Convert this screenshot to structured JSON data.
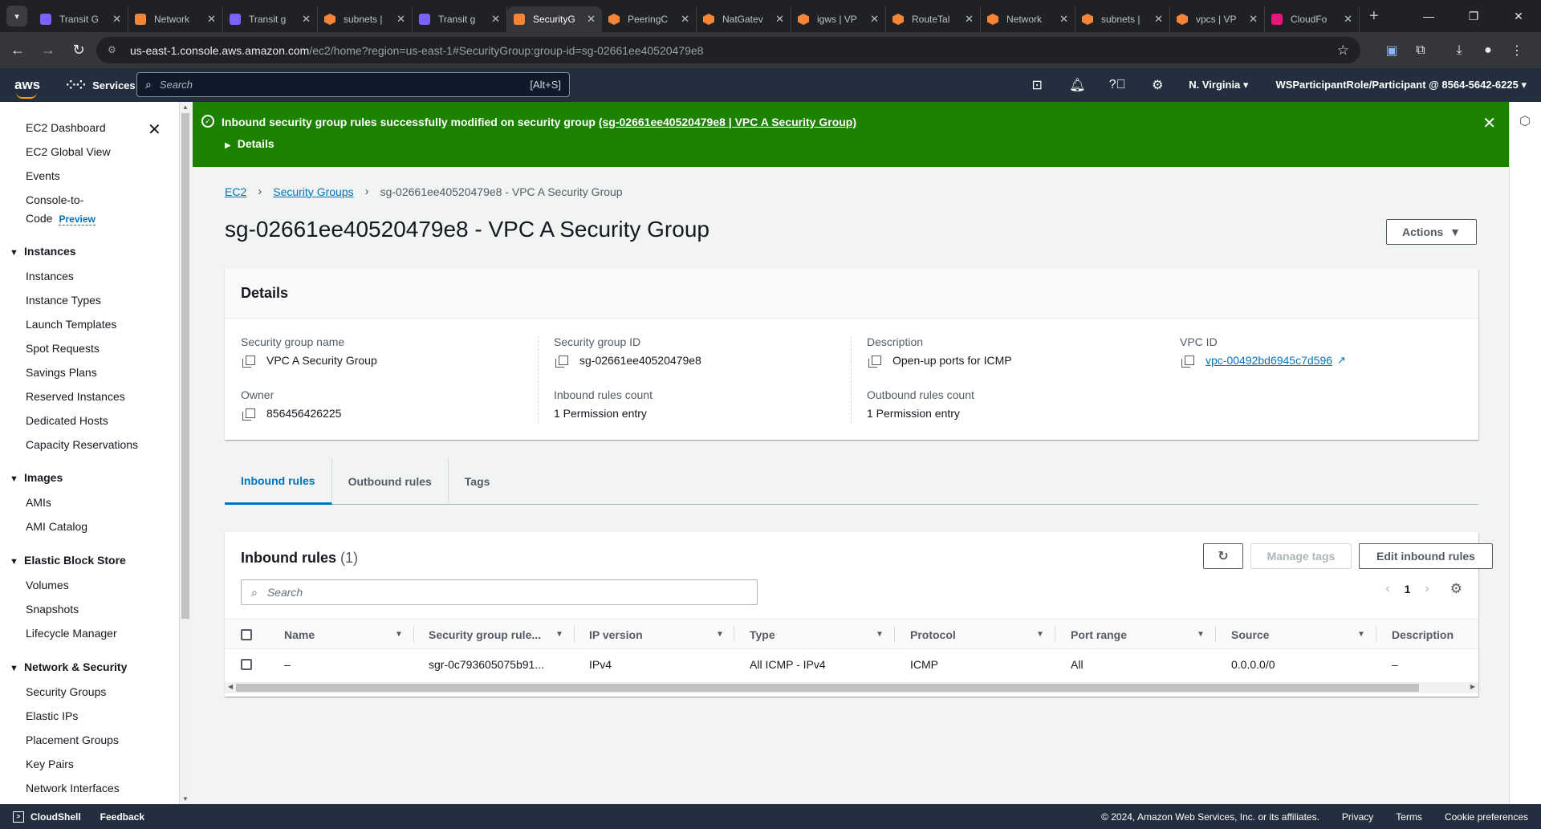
{
  "browser": {
    "menu_icon": "chevron-down-icon",
    "tabs": [
      {
        "label": "Transit G",
        "fav": "purple"
      },
      {
        "label": "Network",
        "fav": "orange"
      },
      {
        "label": "Transit g",
        "fav": "purple"
      },
      {
        "label": "subnets |",
        "fav": "hex"
      },
      {
        "label": "Transit g",
        "fav": "purple"
      },
      {
        "label": "SecurityG",
        "fav": "orange",
        "active": true
      },
      {
        "label": "PeeringC",
        "fav": "hex"
      },
      {
        "label": "NatGatev",
        "fav": "hex"
      },
      {
        "label": "igws | VP",
        "fav": "hex"
      },
      {
        "label": "RouteTal",
        "fav": "hex"
      },
      {
        "label": "Network",
        "fav": "hex"
      },
      {
        "label": "subnets |",
        "fav": "hex"
      },
      {
        "label": "vpcs | VP",
        "fav": "hex"
      },
      {
        "label": "CloudFo",
        "fav": "pink"
      }
    ],
    "url_host": "us-east-1.console.aws.amazon.com",
    "url_path": "/ec2/home?region=us-east-1#SecurityGroup:group-id=sg-02661ee40520479e8"
  },
  "awsnav": {
    "logo": "aws",
    "services": "Services",
    "search_placeholder": "Search",
    "search_shortcut": "[Alt+S]",
    "region": "N. Virginia",
    "account": "WSParticipantRole/Participant @ 8564-5642-6225"
  },
  "sidebar": {
    "items": {
      "dashboard": "EC2 Dashboard",
      "global_view": "EC2 Global View",
      "events": "Events",
      "console_to": "Console-to-",
      "code": "Code",
      "preview": "Preview",
      "instances_section": "Instances",
      "instances": "Instances",
      "instance_types": "Instance Types",
      "launch_templates": "Launch Templates",
      "spot_requests": "Spot Requests",
      "savings_plans": "Savings Plans",
      "reserved_instances": "Reserved Instances",
      "dedicated_hosts": "Dedicated Hosts",
      "capacity_reservations": "Capacity Reservations",
      "images_section": "Images",
      "amis": "AMIs",
      "ami_catalog": "AMI Catalog",
      "ebs_section": "Elastic Block Store",
      "volumes": "Volumes",
      "snapshots": "Snapshots",
      "lifecycle_manager": "Lifecycle Manager",
      "netsec_section": "Network & Security",
      "security_groups": "Security Groups",
      "elastic_ips": "Elastic IPs",
      "placement_groups": "Placement Groups",
      "key_pairs": "Key Pairs",
      "network_interfaces": "Network Interfaces"
    }
  },
  "flash": {
    "message": "Inbound security group rules successfully modified on security group",
    "link": "(sg-02661ee40520479e8 | VPC A Security Group)",
    "details": "Details"
  },
  "breadcrumb": {
    "ec2": "EC2",
    "security_groups": "Security Groups",
    "current": "sg-02661ee40520479e8 - VPC A Security Group"
  },
  "page": {
    "title": "sg-02661ee40520479e8 - VPC A Security Group",
    "actions": "Actions"
  },
  "details": {
    "header": "Details",
    "sg_name_label": "Security group name",
    "sg_name": "VPC A Security Group",
    "sg_id_label": "Security group ID",
    "sg_id": "sg-02661ee40520479e8",
    "desc_label": "Description",
    "desc": "Open-up ports for ICMP",
    "vpc_label": "VPC ID",
    "vpc": "vpc-00492bd6945c7d596",
    "owner_label": "Owner",
    "owner": "856456426225",
    "inbound_label": "Inbound rules count",
    "inbound": "1 Permission entry",
    "outbound_label": "Outbound rules count",
    "outbound": "1 Permission entry"
  },
  "tabs": {
    "inbound": "Inbound rules",
    "outbound": "Outbound rules",
    "tags": "Tags"
  },
  "rules": {
    "title": "Inbound rules",
    "count": "(1)",
    "manage_tags": "Manage tags",
    "edit": "Edit inbound rules",
    "search_placeholder": "Search",
    "page": "1",
    "columns": {
      "name": "Name",
      "rule_id": "Security group rule...",
      "ip_version": "IP version",
      "type": "Type",
      "protocol": "Protocol",
      "port_range": "Port range",
      "source": "Source",
      "description": "Description"
    },
    "row": {
      "name": "–",
      "rule_id": "sgr-0c793605075b91...",
      "ip_version": "IPv4",
      "type": "All ICMP - IPv4",
      "protocol": "ICMP",
      "port_range": "All",
      "source": "0.0.0.0/0",
      "description": "–"
    }
  },
  "footer": {
    "cloudshell": "CloudShell",
    "feedback": "Feedback",
    "copyright": "© 2024, Amazon Web Services, Inc. or its affiliates.",
    "privacy": "Privacy",
    "terms": "Terms",
    "cookies": "Cookie preferences"
  }
}
